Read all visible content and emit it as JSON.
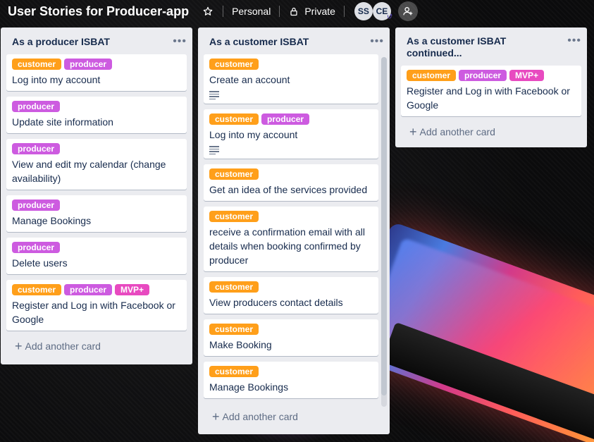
{
  "header": {
    "board_title": "User Stories for Producer-app",
    "visibility_team": "Personal",
    "visibility_privacy": "Private",
    "members": [
      "SS",
      "CE"
    ]
  },
  "lists": [
    {
      "title": "As a producer ISBAT",
      "cards": [
        {
          "labels": [
            "customer",
            "producer"
          ],
          "title": "Log into my account",
          "has_description": false
        },
        {
          "labels": [
            "producer"
          ],
          "title": "Update site information",
          "has_description": false
        },
        {
          "labels": [
            "producer"
          ],
          "title": "View and edit my calendar (change availability)",
          "has_description": false
        },
        {
          "labels": [
            "producer"
          ],
          "title": "Manage Bookings",
          "has_description": false
        },
        {
          "labels": [
            "producer"
          ],
          "title": "Delete users",
          "has_description": false
        },
        {
          "labels": [
            "customer",
            "producer",
            "MVP+"
          ],
          "title": "Register and Log in with Facebook or Google",
          "has_description": false
        }
      ],
      "add_card_label": "Add another card"
    },
    {
      "title": "As a customer ISBAT",
      "cards": [
        {
          "labels": [
            "customer"
          ],
          "title": "Create an account",
          "has_description": true
        },
        {
          "labels": [
            "customer",
            "producer"
          ],
          "title": "Log into my account",
          "has_description": true
        },
        {
          "labels": [
            "customer"
          ],
          "title": "Get an idea of the services provided",
          "has_description": false
        },
        {
          "labels": [
            "customer"
          ],
          "title": "receive a confirmation email with all details when booking confirmed by producer",
          "has_description": false
        },
        {
          "labels": [
            "customer"
          ],
          "title": "View producers contact details",
          "has_description": false
        },
        {
          "labels": [
            "customer"
          ],
          "title": "Make Booking",
          "has_description": false
        },
        {
          "labels": [
            "customer"
          ],
          "title": "Manage Bookings",
          "has_description": false
        }
      ],
      "add_card_label": "Add another card"
    },
    {
      "title": "As a customer ISBAT continued...",
      "cards": [
        {
          "labels": [
            "customer",
            "producer",
            "MVP+"
          ],
          "title": "Register and Log in with Facebook or Google",
          "has_description": false
        }
      ],
      "add_card_label": "Add another card"
    }
  ],
  "colors": {
    "customer_label": "#ff9f1a",
    "producer_label": "#cd5be0",
    "mvp_label": "#e84ac0",
    "list_bg": "#ebecf0"
  }
}
